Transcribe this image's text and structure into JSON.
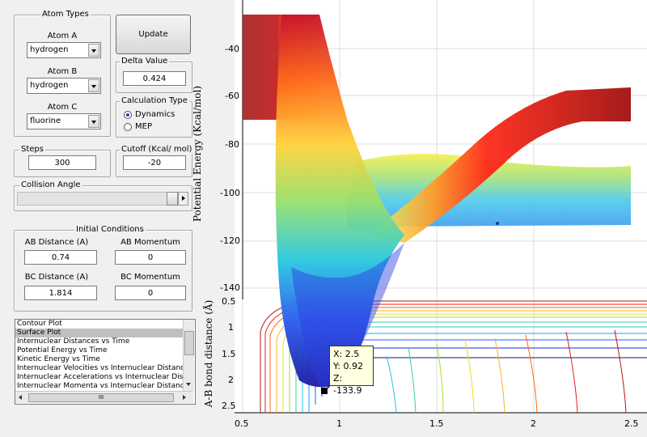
{
  "atom_types": {
    "title": "Atom Types",
    "atom_a": {
      "label": "Atom A",
      "value": "hydrogen"
    },
    "atom_b": {
      "label": "Atom B",
      "value": "hydrogen"
    },
    "atom_c": {
      "label": "Atom C",
      "value": "fluorine"
    }
  },
  "update_button": "Update",
  "delta": {
    "title": "Delta Value",
    "value": "0.424"
  },
  "calc_type": {
    "title": "Calculation Type",
    "options": [
      "Dynamics",
      "MEP"
    ],
    "selected": "Dynamics"
  },
  "steps": {
    "title": "Steps",
    "value": "300"
  },
  "cutoff": {
    "title": "Cutoff (Kcal/ mol)",
    "value": "-20"
  },
  "collision": {
    "title": "Collision Angle"
  },
  "initial": {
    "title": "Initial Conditions",
    "ab_distance": {
      "label": "AB Distance (A)",
      "value": "0.74"
    },
    "ab_momentum": {
      "label": "AB Momentum",
      "value": "0"
    },
    "bc_distance": {
      "label": "BC Distance (A)",
      "value": "1.814"
    },
    "bc_momentum": {
      "label": "BC Momentum",
      "value": "0"
    }
  },
  "plot_list": {
    "items": [
      "Contour Plot",
      "Surface Plot",
      "Internuclear Distances vs Time",
      "Potential Energy vs Time",
      "Kinetic Energy vs Time",
      "Internuclear Velocities vs Internuclear Distance",
      "Internuclear Accelerations vs Internuclear Dista",
      "Internuclear Momenta vs Internuclear Distance"
    ],
    "selected": "Surface Plot",
    "scroll_thumb": "III"
  },
  "chart_data": {
    "type": "surface",
    "zlabel": "Potential Energy (Kcal/mol)",
    "ylabel": "A-B bond distance (Å)",
    "z_ticks": [
      "-40",
      "-60",
      "-80",
      "-100",
      "-120",
      "-140"
    ],
    "y_ticks": [
      "0.5",
      "1",
      "1.5",
      "2",
      "2.5"
    ],
    "x_ticks": [
      "0.5",
      "1",
      "1.5",
      "2",
      "2.5"
    ],
    "datatip": {
      "x": "X: 2.5",
      "y": "Y: 0.92",
      "z": "Z: -133.9"
    }
  }
}
